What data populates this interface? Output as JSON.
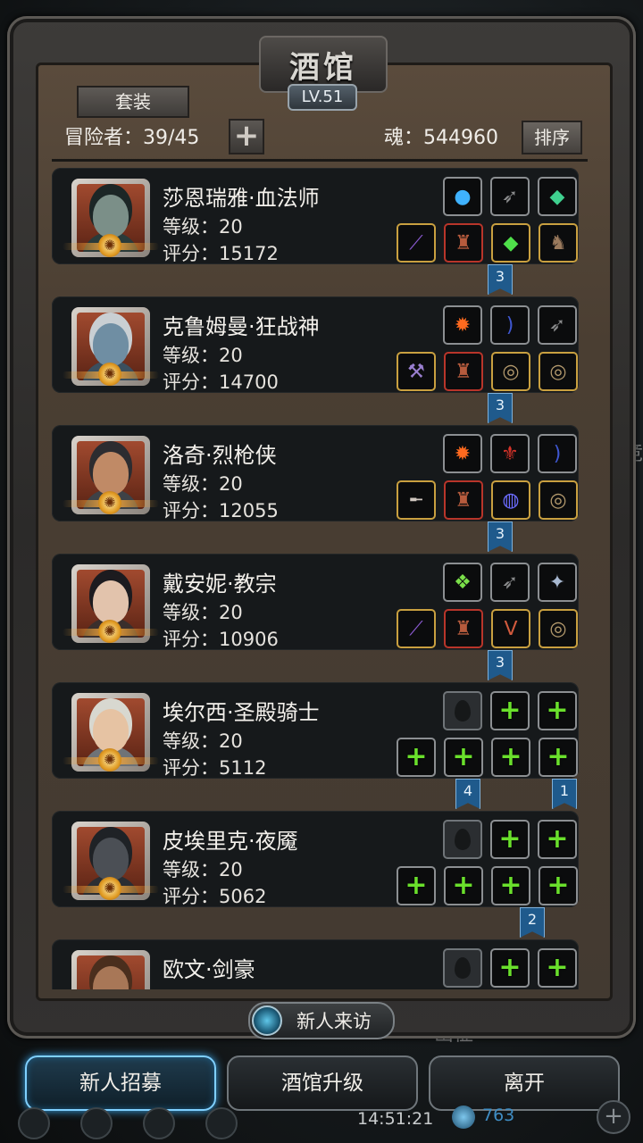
{
  "header": {
    "title": "酒馆",
    "level_badge": "LV.51",
    "suit_button": "套装",
    "adventurers_label": "冒险者：39/45",
    "add_button": "+",
    "soul_label": "魂：544960",
    "sort_button": "排序"
  },
  "heroes": [
    {
      "name": "莎恩瑞雅·血法师",
      "level": "等级：20",
      "score": "评分：15172",
      "flags": [
        "3"
      ],
      "top_slots": [
        "orb-icon",
        "feather-icon",
        "gem-icon"
      ],
      "bottom_slots": [
        "staff-icon",
        "armor-icon",
        "emerald-icon",
        "boots-icon"
      ]
    },
    {
      "name": "克鲁姆曼·狂战神",
      "level": "等级：20",
      "score": "评分：14700",
      "flags": [
        "3"
      ],
      "top_slots": [
        "fire-icon",
        "bow-icon",
        "feather-icon"
      ],
      "bottom_slots": [
        "axe-icon",
        "armor-icon",
        "ring-icon",
        "ring-icon"
      ]
    },
    {
      "name": "洛奇·烈枪侠",
      "level": "等级：20",
      "score": "评分：12055",
      "flags": [
        "3"
      ],
      "top_slots": [
        "fire-icon",
        "crest-icon",
        "bow-icon"
      ],
      "bottom_slots": [
        "gun-icon",
        "armor-icon",
        "bracelet-icon",
        "ring-icon"
      ]
    },
    {
      "name": "戴安妮·教宗",
      "level": "等级：20",
      "score": "评分：10906",
      "flags": [
        "3"
      ],
      "top_slots": [
        "crystal-icon",
        "feather-icon",
        "star-icon"
      ],
      "bottom_slots": [
        "staff-icon",
        "armor-icon",
        "necklace-icon",
        "ring-icon"
      ]
    },
    {
      "name": "埃尔西·圣殿骑士",
      "level": "等级：20",
      "score": "评分：5112",
      "flags": [
        "4",
        "1"
      ],
      "top_slots": [
        "empty",
        "plus",
        "plus"
      ],
      "bottom_slots": [
        "plus",
        "plus",
        "plus",
        "plus"
      ]
    },
    {
      "name": "皮埃里克·夜魇",
      "level": "等级：20",
      "score": "评分：5062",
      "flags": [
        "2"
      ],
      "top_slots": [
        "empty",
        "plus",
        "plus"
      ],
      "bottom_slots": [
        "plus",
        "plus",
        "plus",
        "plus"
      ]
    },
    {
      "name": "欧文·剑豪",
      "level": "",
      "score": "",
      "flags": [],
      "top_slots": [
        "empty",
        "plus",
        "plus"
      ],
      "bottom_slots": []
    }
  ],
  "visitor_button": "新人来访",
  "bottom_buttons": {
    "recruit": "新人招募",
    "upgrade": "酒馆升级",
    "leave": "离开"
  },
  "background": {
    "clock": "14:51:21",
    "currency_value": "763",
    "mid_text": "出征",
    "right_text": "竞"
  },
  "colors": {
    "accent_blue": "#3aa6e8",
    "plus_green": "#6ae02c",
    "flag_blue": "#1f5a8c"
  }
}
